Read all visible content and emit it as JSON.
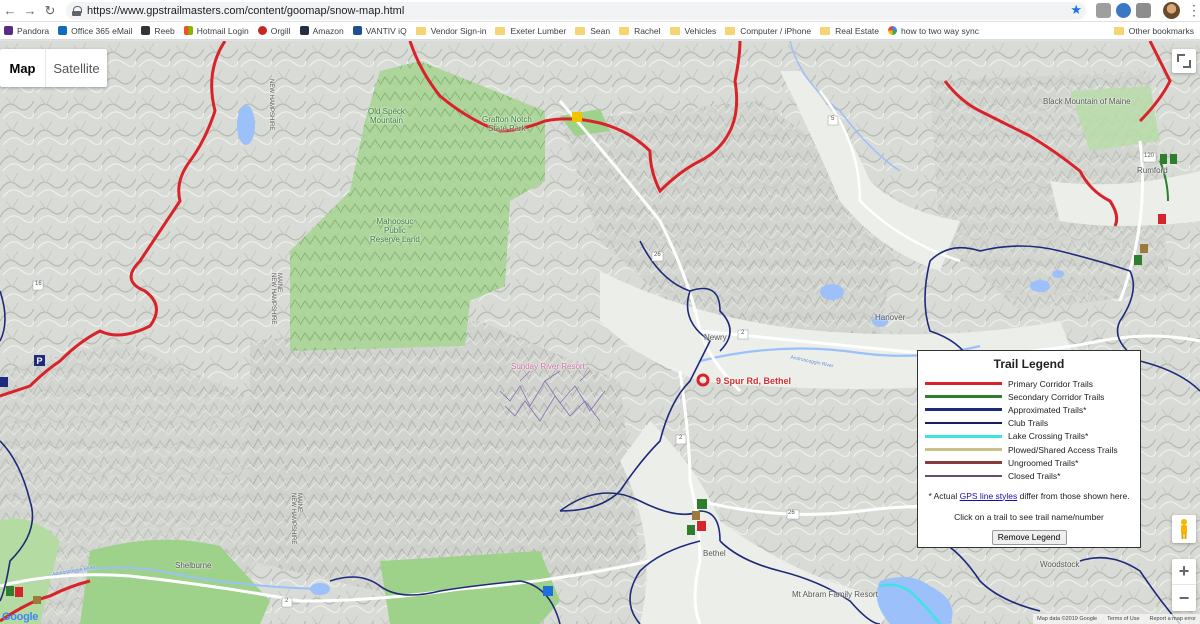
{
  "browser": {
    "url": "https://www.gpstrailmasters.com/content/goomap/snow-map.html",
    "bookmarks": [
      "Pandora",
      "Office 365 eMail",
      "Reeb",
      "Hotmail Login",
      "Orgill",
      "Amazon",
      "VANTIV iQ",
      "Vendor Sign-in",
      "Exeter Lumber",
      "Sean",
      "Rachel",
      "Vehicles",
      "Computer / iPhone",
      "Real Estate",
      "how to two way sync"
    ],
    "other_bookmarks": "Other bookmarks"
  },
  "map": {
    "type_controls": {
      "map": "Map",
      "satellite": "Satellite"
    },
    "zoom_in": "+",
    "zoom_out": "−",
    "destination_label": "9 Spur Rd, Bethel",
    "places": {
      "old_speck": "Old Speck\nMountain",
      "grafton": "Grafton Notch\nState Park",
      "mahoosuc": "Mahoosuc\nPublic\nReserve Land",
      "sunday_river": "Sunday River Resort",
      "black_mountain": "Black Mountain of Maine",
      "rumford": "Rumford",
      "hanover": "Hanover",
      "newry": "Newry",
      "bethel": "Bethel",
      "shelburne": "Shelburne",
      "woodstock": "Woodstock",
      "mt_abram": "Mt Abram Family Resort",
      "nh_maine_top": "NEW HAMPSHIRE",
      "nh_maine_mid": "MAINE\nNEW HAMPSHIRE",
      "nh_maine_bottom": "MAINE\nNEW HAMPSHIRE",
      "r2": "2",
      "r5": "5",
      "r26": "26",
      "r16": "16",
      "r120": "120",
      "r2b": "2",
      "r2c": "2",
      "r26b": "26",
      "androscoggin": "Androscoggin River",
      "androscoggin2": "Androscoggin River"
    },
    "attribution": [
      "Map data ©2019 Google",
      "Terms of Use",
      "Report a map error"
    ],
    "google": "Google"
  },
  "legend": {
    "title": "Trail Legend",
    "items": [
      {
        "label": "Primary Corridor Trails",
        "color": "#d9232a"
      },
      {
        "label": "Secondary Corridor Trails",
        "color": "#2f7d2f"
      },
      {
        "label": "Approximated Trails*",
        "color": "#1e2a7a"
      },
      {
        "label": "Club Trails",
        "color": "#161d5e"
      },
      {
        "label": "Lake Crossing Trails*",
        "color": "#3fe3e3"
      },
      {
        "label": "Plowed/Shared Access Trails",
        "color": "#c9c08a"
      },
      {
        "label": "Ungroomed Trails*",
        "color": "#8a3a3a"
      },
      {
        "label": "Closed Trails*",
        "color": "#6a4a72"
      }
    ],
    "note_prefix": "* Actual ",
    "note_link": "GPS line styles",
    "note_suffix": " differ from those shown here.",
    "click_hint": "Click on a trail to see trail name/number",
    "remove_button": "Remove Legend"
  }
}
